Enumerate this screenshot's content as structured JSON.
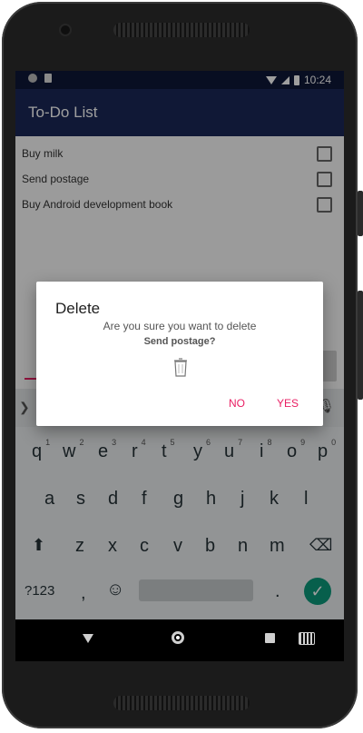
{
  "status": {
    "time": "10:24"
  },
  "app": {
    "title": "To-Do List"
  },
  "tasks": [
    {
      "label": "Buy milk",
      "checked": false
    },
    {
      "label": "Send postage",
      "checked": false
    },
    {
      "label": "Buy Android development book",
      "checked": false
    }
  ],
  "dialog": {
    "title": "Delete",
    "message": "Are you sure you want to delete",
    "item_name": "Send postage?",
    "no_label": "NO",
    "yes_label": "YES",
    "accent_color": "#e91e63"
  },
  "keyboard": {
    "row1": [
      "q",
      "w",
      "e",
      "r",
      "t",
      "y",
      "u",
      "i",
      "o",
      "p"
    ],
    "row1_digits": [
      "1",
      "2",
      "3",
      "4",
      "5",
      "6",
      "7",
      "8",
      "9",
      "0"
    ],
    "row2": [
      "a",
      "s",
      "d",
      "f",
      "g",
      "h",
      "j",
      "k",
      "l"
    ],
    "row3": [
      "z",
      "x",
      "c",
      "v",
      "b",
      "n",
      "m"
    ],
    "symbols_label": "?123",
    "comma": ",",
    "period": ".",
    "emoji_icon": "☺"
  },
  "colors": {
    "appbar": "#1a2858",
    "statusbar": "#0e1838",
    "enter_key": "#0c9a7b"
  }
}
